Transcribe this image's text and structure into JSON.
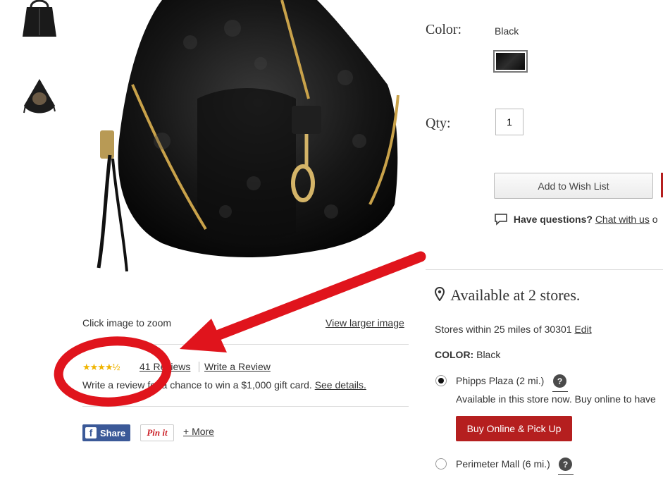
{
  "gallery": {
    "thumbnails": [
      "bag-thumbnail-front",
      "bag-thumbnail-open"
    ]
  },
  "image_actions": {
    "zoom_hint": "Click image to zoom",
    "view_larger": "View larger image"
  },
  "reviews": {
    "rating": 4.5,
    "count_label": "41",
    "reviews_word": "Reviews",
    "write_review": "Write a Review",
    "promo_text": "Write a review for a chance to win a $1,000 gift card.",
    "promo_link": "See details."
  },
  "share": {
    "facebook": "Share",
    "pinterest": "Pin it",
    "more": "+ More"
  },
  "product": {
    "color_label": "Color:",
    "color_value": "Black",
    "qty_label": "Qty:",
    "qty_value": "1",
    "wishlist_button": "Add to Wish List",
    "questions_label": "Have questions?",
    "chat_link": "Chat with us",
    "chat_trailing": "o"
  },
  "availability": {
    "title": "Available at 2 stores.",
    "within_text": "Stores within 25 miles of 30301",
    "edit_link": "Edit",
    "color_label": "COLOR:",
    "color_value": "Black",
    "stores": [
      {
        "name": "Phipps Plaza (2 mi.)",
        "selected": true,
        "note": "Available in this store now. Buy online to have"
      },
      {
        "name": "Perimeter Mall (6 mi.)",
        "selected": false
      }
    ],
    "pickup_button": "Buy Online & Pick Up"
  },
  "colors": {
    "accent_red": "#b51f1f",
    "facebook_blue": "#3b5998",
    "pinterest_red": "#cb2027",
    "star_gold": "#f0b400",
    "annotation_red": "#e0141c"
  }
}
